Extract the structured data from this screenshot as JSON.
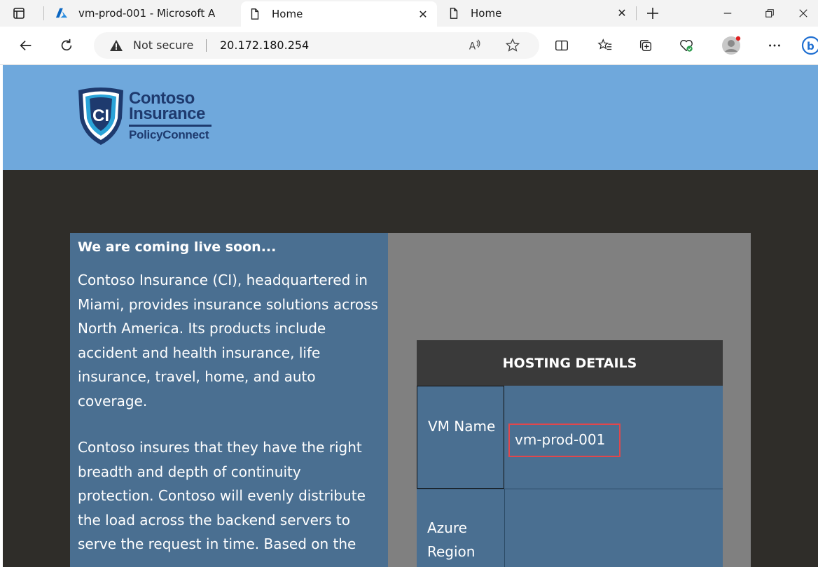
{
  "browser": {
    "tabs": [
      {
        "title": "vm-prod-001 - Microsoft A",
        "active": false,
        "icon": "azure-logo-icon"
      },
      {
        "title": "Home",
        "active": true,
        "icon": "page-icon"
      },
      {
        "title": "Home",
        "active": false,
        "icon": "page-icon"
      }
    ],
    "address": {
      "security_label": "Not secure",
      "url": "20.172.180.254"
    }
  },
  "site": {
    "logo": {
      "line1": "Contoso",
      "line2": "Insurance",
      "line3": "PolicyConnect",
      "badge_text": "CI"
    },
    "intro": {
      "heading": "We are coming live soon...",
      "paragraph1": "Contoso Insurance (CI), headquartered in Miami, provides insurance solutions across North America. Its products include accident and health insurance, life insurance, travel, home, and auto coverage.",
      "paragraph2": "Contoso insures that they have the right breadth and depth of continuity protection. Contoso will evenly distribute the load across the backend servers to serve the request in time. Based on the"
    },
    "hosting": {
      "title": "HOSTING DETAILS",
      "rows": [
        {
          "label": "VM Name",
          "value": "vm-prod-001"
        },
        {
          "label": "Azure Region",
          "value": ""
        }
      ]
    }
  },
  "colors": {
    "header_blue": "#6fa8dc",
    "panel_blue": "#4a6f91",
    "highlight_red": "#e0474c",
    "page_dark": "#2f2d29"
  }
}
